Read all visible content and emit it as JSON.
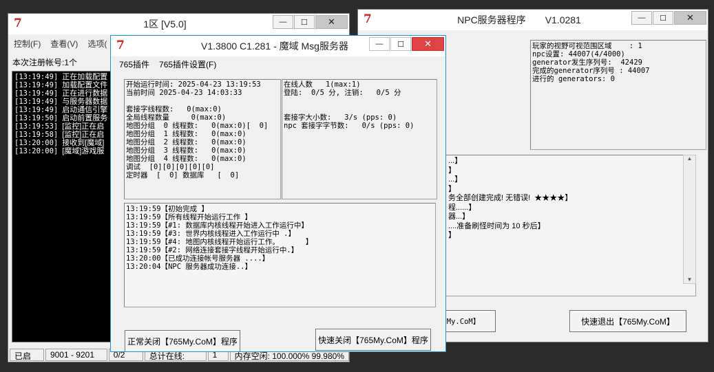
{
  "login_window": {
    "title": "1区 [V5.0]",
    "menu": [
      "控制(F)",
      "查看(V)",
      "选项("
    ],
    "register_label": "本次注册帐号:1个",
    "log": [
      {
        "time": "[13:19:49]",
        "text": "正在加载配置"
      },
      {
        "time": "[13:19:49]",
        "text": "加载配置文件"
      },
      {
        "time": "[13:19:49]",
        "text": "正在进行数据"
      },
      {
        "time": "[13:19:49]",
        "text": "与服务器数据"
      },
      {
        "time": "[13:19:49]",
        "text": "启动通信引擎"
      },
      {
        "time": "[13:19:50]",
        "text": "启动前置服务"
      },
      {
        "time": "[13:19:53]",
        "text": "[监控]正在启"
      },
      {
        "time": "[13:19:58]",
        "text": "[监控]正在启"
      },
      {
        "time": "[13:20:00]",
        "text": "接收到[魔域]"
      },
      {
        "time": "[13:20:00]",
        "text": "[魔域]游戏服"
      }
    ],
    "status": [
      "已启动",
      "9001 - 9201",
      "0/2",
      "总计在线:",
      "1",
      "内存空闲: 100.000% 99.980%"
    ]
  },
  "npc_window": {
    "title": "NPC服务器程序",
    "version": "V1.0281",
    "info": [
      "玩家的视野可视范围区域    : 1",
      "npc设置: 44007(4/4000)",
      "generator发生序列号:  42429",
      "完成的generator序列号 : 44007",
      "进行的 generators: 0"
    ],
    "log": [
      "...】",
      "】",
      "...】",
      "】",
      "务全部创建完成! 无错误!  ★★★★】",
      "程......】",
      "器...】",
      "....准备刷怪时间为 10 秒后】",
      "】"
    ],
    "buttons": {
      "left_fragment": "My.CoM】",
      "fast_exit": "快速退出【765My.CoM】"
    }
  },
  "msg_window": {
    "title": "V1.3800 C1.281  - 魔域  Msg服务器",
    "menu": [
      "765插件",
      "765插件设置(F)"
    ],
    "left_info": [
      "开始运行时间: 2025-04-23 13:19:53",
      "当前时间 2025-04-23 14:03:33",
      "",
      "套接字线程数:   0(max:0)",
      "全局线程数量     0(max:0)",
      "地图分组  0 线程数:   0(max:0)[  0]",
      "地图分组  1 线程数:   0(max:0)",
      "地图分组  2 线程数:   0(max:0)",
      "地图分组  3 线程数:   0(max:0)",
      "地图分组  4 线程数:   0(max:0)",
      "调试  [0][0][0][0][0]",
      "定时器  [  0] 数据库   [  0]"
    ],
    "right_info": [
      "在线人数   1(max:1)",
      "登陆:  0/5 分, 注销:   0/5 分",
      "",
      "",
      "套接字大小数:   3/s (pps: 0)",
      "npc 套接字字节数:   0/s (pps: 0)"
    ],
    "log": [
      "13:19:59【初始完成 】",
      "13:19:59【所有线程开始运行工作 】",
      "13:19:59【#1: 数据库内核线程开始进入工作运行中】",
      "13:19:59【#3: 世界内核线程进入工作运行中 .】",
      "13:19:59【#4: 地图内核线程开始运行工作。      】",
      "13:19:59【#2: 网络连接套接字线程开始运行中.】",
      "13:20:00【已成功连接帐号服务器 ....】",
      "13:20:04【NPC 服务器成功连接..】"
    ],
    "buttons": {
      "normal_close": "正常关闭【765My.CoM】程序",
      "fast_close": "快速关闭【765My.CoM】程序"
    }
  },
  "window_controls": {
    "minimize": "—",
    "maximize": "☐",
    "close": "✕"
  },
  "colors": {
    "app_icon": "#d21b1b",
    "active_border": "#1e90d8",
    "close_hover": "#e81123"
  }
}
